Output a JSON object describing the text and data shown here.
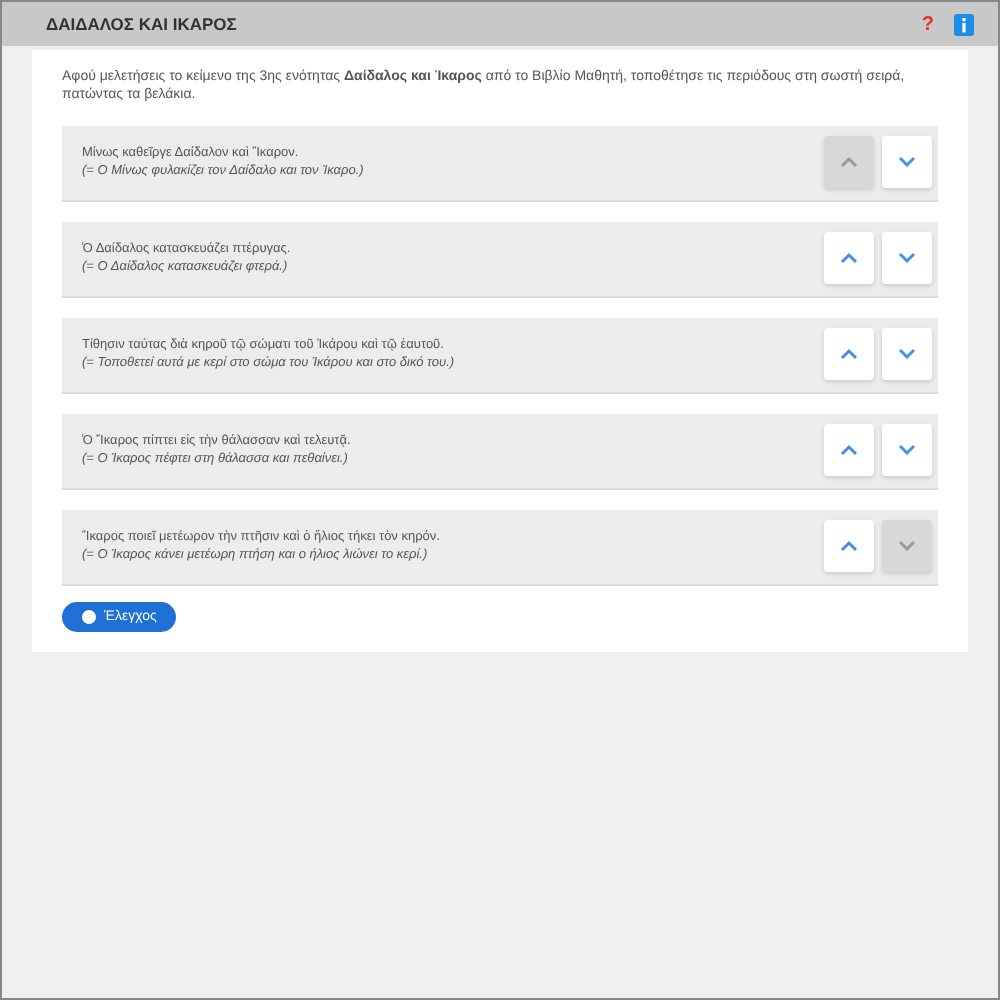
{
  "header": {
    "title": "ΔΑΙΔΑΛΟΣ ΚΑΙ ΙΚΑΡΟΣ",
    "help": "?"
  },
  "instruction": "Αφού μελετήσεις το κείμενο της 3ης ενότητας **Δαίδαλος και Ίκαρος** από το Βιβλίο Μαθητή, τοποθέτησε τις περιόδους στη σωστή σειρά, πατώντας τα βελάκια.",
  "items": [
    {
      "text": "Μίνως καθεῖργε Δαίδαλον καὶ Ἴκαρον.",
      "translation": "(= Ο Μίνως φυλακίζει τον Δαίδαλο και τον Ίκαρο.)",
      "up_disabled": true,
      "down_disabled": false
    },
    {
      "text": "Ὁ Δαίδαλος κατασκευάζει πτέρυγας.",
      "translation": "(= Ο Δαίδαλος κατασκευάζει φτερά.)",
      "up_disabled": false,
      "down_disabled": false
    },
    {
      "text": "Τίθησιν ταύτας διὰ κηροῦ τῷ σώματι τοῦ Ἰκάρου καὶ τῷ ἑαυτοῦ.",
      "translation": "(= Τοποθετεί αυτά με κερί στο σώμα του Ίκάρου και στο δικό του.)",
      "up_disabled": false,
      "down_disabled": false
    },
    {
      "text": "Ὁ Ἴκαρος πίπτει εἰς τὴν θάλασσαν καὶ τελευτᾷ.",
      "translation": "(= Ο Ίκαρος πέφτει στη θάλασσα και πεθαίνει.)",
      "up_disabled": false,
      "down_disabled": false
    },
    {
      "text": "Ἴκαρος ποιεῖ μετέωρον τὴν πτῆσιν καὶ ὁ ἥλιος τήκει τὸν κηρόν.",
      "translation": "(= Ο Ίκαρος κάνει μετέωρη πτήση και ο ήλιος λιώνει το κερί.)",
      "up_disabled": false,
      "down_disabled": true
    }
  ],
  "check_button": "Έλεγχος"
}
